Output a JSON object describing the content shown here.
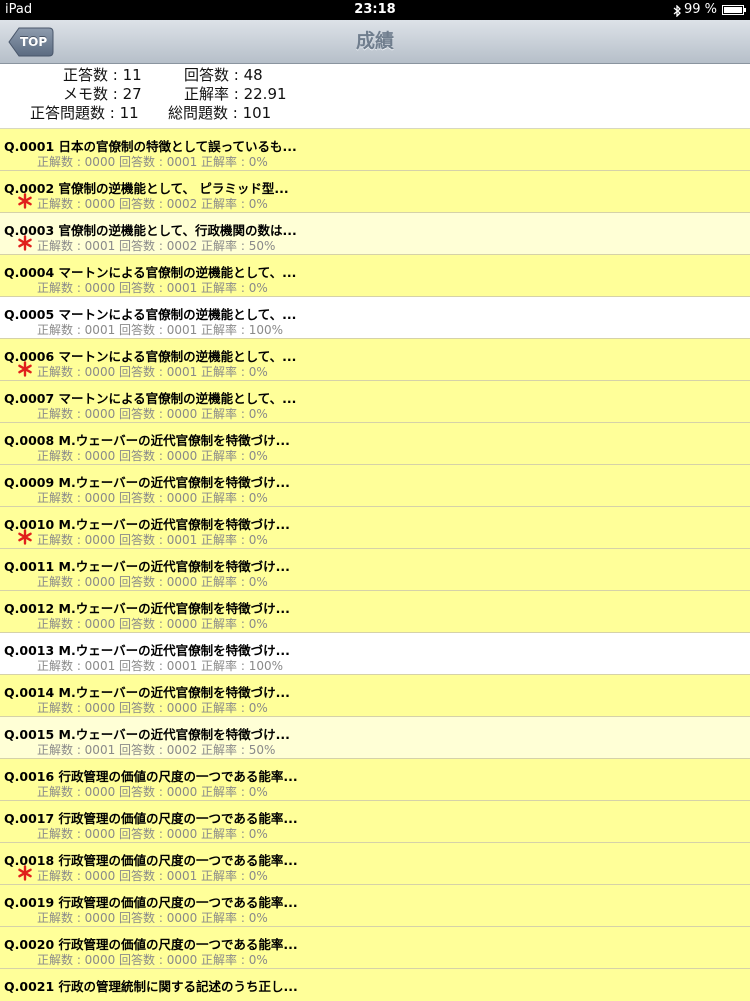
{
  "status_bar": {
    "device": "iPad",
    "time": "23:18",
    "battery_pct": "99 %",
    "battery_level": 0.99
  },
  "nav": {
    "title": "成績",
    "back_label": "TOP"
  },
  "summary": {
    "correct_count": "正答数 : 11",
    "answer_count": "回答数 : 48",
    "memo_count": "メモ数 : 27",
    "correct_rate": "正解率 : 22.91",
    "correct_questions": "正答問題数 : 11",
    "total_questions": "総問題数 : 101"
  },
  "questions": [
    {
      "title": "Q.0001 日本の官僚制の特徴として誤っているも...",
      "stats": "正解数 : 0000 回答数 : 0001 正解率 : 0%",
      "memo": false,
      "color": "yellow"
    },
    {
      "title": "Q.0002 官僚制の逆機能として、 ピラミッド型...",
      "stats": "正解数 : 0000 回答数 : 0002 正解率 : 0%",
      "memo": true,
      "color": "yellow"
    },
    {
      "title": "Q.0003 官僚制の逆機能として、行政機関の数は...",
      "stats": "正解数 : 0001 回答数 : 0002 正解率 : 50%",
      "memo": true,
      "color": "lightyellow"
    },
    {
      "title": "Q.0004 マートンによる官僚制の逆機能として、...",
      "stats": "正解数 : 0000 回答数 : 0001 正解率 : 0%",
      "memo": false,
      "color": "yellow"
    },
    {
      "title": "Q.0005 マートンによる官僚制の逆機能として、...",
      "stats": "正解数 : 0001 回答数 : 0001 正解率 : 100%",
      "memo": false,
      "color": "white"
    },
    {
      "title": "Q.0006 マートンによる官僚制の逆機能として、...",
      "stats": "正解数 : 0000 回答数 : 0001 正解率 : 0%",
      "memo": true,
      "color": "yellow"
    },
    {
      "title": "Q.0007 マートンによる官僚制の逆機能として、...",
      "stats": "正解数 : 0000 回答数 : 0000 正解率 : 0%",
      "memo": false,
      "color": "yellow"
    },
    {
      "title": "Q.0008 M.ウェーバーの近代官僚制を特徴づけ...",
      "stats": "正解数 : 0000 回答数 : 0000 正解率 : 0%",
      "memo": false,
      "color": "yellow"
    },
    {
      "title": "Q.0009 M.ウェーバーの近代官僚制を特徴づけ...",
      "stats": "正解数 : 0000 回答数 : 0000 正解率 : 0%",
      "memo": false,
      "color": "yellow"
    },
    {
      "title": "Q.0010 M.ウェーバーの近代官僚制を特徴づけ...",
      "stats": "正解数 : 0000 回答数 : 0001 正解率 : 0%",
      "memo": true,
      "color": "yellow"
    },
    {
      "title": "Q.0011 M.ウェーバーの近代官僚制を特徴づけ...",
      "stats": "正解数 : 0000 回答数 : 0000 正解率 : 0%",
      "memo": false,
      "color": "yellow"
    },
    {
      "title": "Q.0012 M.ウェーバーの近代官僚制を特徴づけ...",
      "stats": "正解数 : 0000 回答数 : 0000 正解率 : 0%",
      "memo": false,
      "color": "yellow"
    },
    {
      "title": "Q.0013 M.ウェーバーの近代官僚制を特徴づけ...",
      "stats": "正解数 : 0001 回答数 : 0001 正解率 : 100%",
      "memo": false,
      "color": "white"
    },
    {
      "title": "Q.0014 M.ウェーバーの近代官僚制を特徴づけ...",
      "stats": "正解数 : 0000 回答数 : 0000 正解率 : 0%",
      "memo": false,
      "color": "yellow"
    },
    {
      "title": "Q.0015 M.ウェーバーの近代官僚制を特徴づけ...",
      "stats": "正解数 : 0001 回答数 : 0002 正解率 : 50%",
      "memo": false,
      "color": "lightyellow"
    },
    {
      "title": "Q.0016 行政管理の価値の尺度の一つである能率...",
      "stats": "正解数 : 0000 回答数 : 0000 正解率 : 0%",
      "memo": false,
      "color": "yellow"
    },
    {
      "title": "Q.0017 行政管理の価値の尺度の一つである能率...",
      "stats": "正解数 : 0000 回答数 : 0000 正解率 : 0%",
      "memo": false,
      "color": "yellow"
    },
    {
      "title": "Q.0018 行政管理の価値の尺度の一つである能率...",
      "stats": "正解数 : 0000 回答数 : 0001 正解率 : 0%",
      "memo": true,
      "color": "yellow"
    },
    {
      "title": "Q.0019 行政管理の価値の尺度の一つである能率...",
      "stats": "正解数 : 0000 回答数 : 0000 正解率 : 0%",
      "memo": false,
      "color": "yellow"
    },
    {
      "title": "Q.0020 行政管理の価値の尺度の一つである能率...",
      "stats": "正解数 : 0000 回答数 : 0000 正解率 : 0%",
      "memo": false,
      "color": "yellow"
    },
    {
      "title": "Q.0021 行政の管理統制に関する記述のうち正し...",
      "stats": "",
      "memo": false,
      "color": "yellow"
    }
  ]
}
